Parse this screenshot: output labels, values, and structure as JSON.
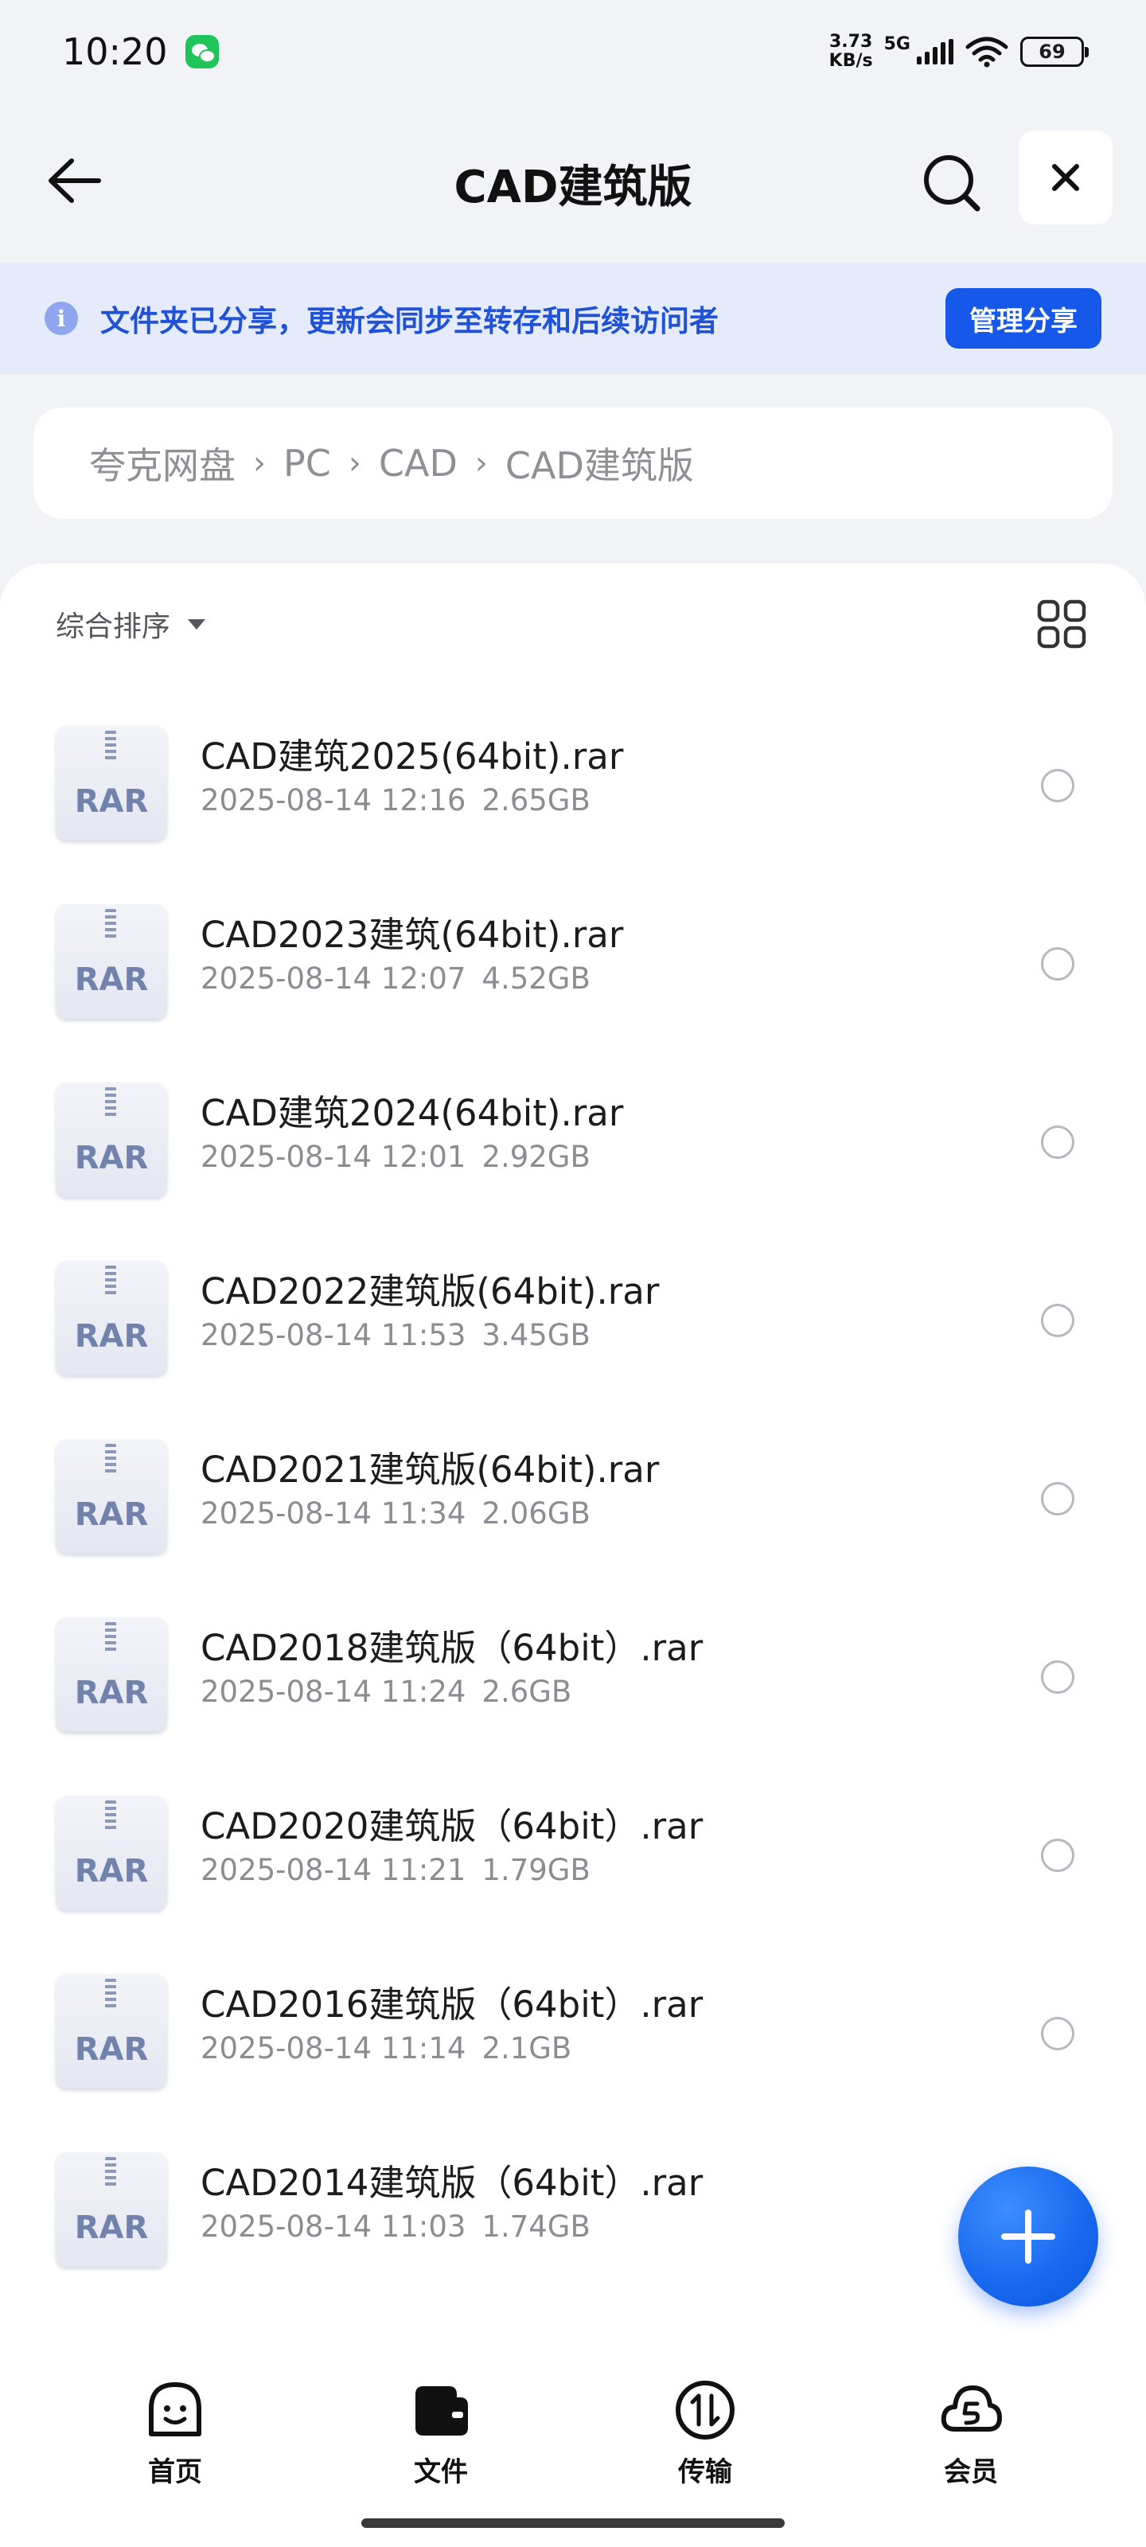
{
  "status_bar": {
    "time": "10:20",
    "speed_value": "3.73",
    "speed_unit": "KB/s",
    "network": "5G",
    "battery": "69"
  },
  "header": {
    "title": "CAD建筑版"
  },
  "share_notice": {
    "text": "文件夹已分享，更新会同步至转存和后续访问者",
    "button": "管理分享"
  },
  "breadcrumb": [
    "夸克网盘",
    "PC",
    "CAD",
    "CAD建筑版"
  ],
  "sort": {
    "label": "综合排序"
  },
  "files": [
    {
      "icon_label": "RAR",
      "name": "CAD建筑2025(64bit).rar",
      "date": "2025-08-14 12:16",
      "size": "2.65GB"
    },
    {
      "icon_label": "RAR",
      "name": "CAD2023建筑(64bit).rar",
      "date": "2025-08-14 12:07",
      "size": "4.52GB"
    },
    {
      "icon_label": "RAR",
      "name": "CAD建筑2024(64bit).rar",
      "date": "2025-08-14 12:01",
      "size": "2.92GB"
    },
    {
      "icon_label": "RAR",
      "name": "CAD2022建筑版(64bit).rar",
      "date": "2025-08-14 11:53",
      "size": "3.45GB"
    },
    {
      "icon_label": "RAR",
      "name": "CAD2021建筑版(64bit).rar",
      "date": "2025-08-14 11:34",
      "size": "2.06GB"
    },
    {
      "icon_label": "RAR",
      "name": "CAD2018建筑版（64bit）.rar",
      "date": "2025-08-14 11:24",
      "size": "2.6GB"
    },
    {
      "icon_label": "RAR",
      "name": "CAD2020建筑版（64bit）.rar",
      "date": "2025-08-14 11:21",
      "size": "1.79GB"
    },
    {
      "icon_label": "RAR",
      "name": "CAD2016建筑版（64bit）.rar",
      "date": "2025-08-14 11:14",
      "size": "2.1GB"
    },
    {
      "icon_label": "RAR",
      "name": "CAD2014建筑版（64bit）.rar",
      "date": "2025-08-14 11:03",
      "size": "1.74GB"
    }
  ],
  "bottom_nav": [
    {
      "label": "首页",
      "icon": "home-face-icon"
    },
    {
      "label": "文件",
      "icon": "folder-icon"
    },
    {
      "label": "传输",
      "icon": "transfer-icon"
    },
    {
      "label": "会员",
      "icon": "vip-cloud-icon"
    }
  ],
  "colors": {
    "accent": "#1659ea",
    "banner_bg": "#e6ebfb",
    "banner_text": "#1f52d6",
    "page_bg": "#f2f3f6"
  }
}
